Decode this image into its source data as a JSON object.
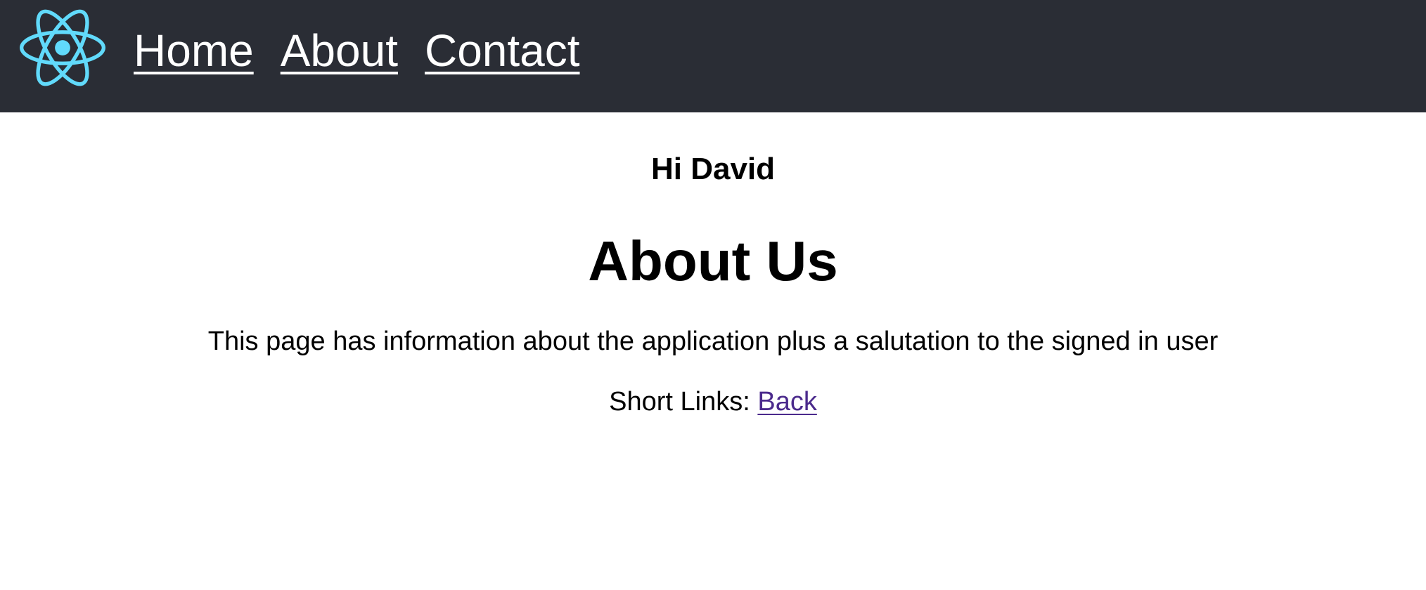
{
  "navbar": {
    "logo_icon": "react-atom-icon",
    "logo_color": "#61dafb",
    "background_color": "#2a2d35",
    "links": [
      {
        "label": "Home"
      },
      {
        "label": "About"
      },
      {
        "label": "Contact"
      }
    ]
  },
  "main": {
    "greeting": "Hi David",
    "title": "About Us",
    "description": "This page has information about the application plus a salutation to the signed in user",
    "short_links_label": "Short Links: ",
    "back_link": "Back",
    "back_link_color": "#4b2a8c"
  }
}
